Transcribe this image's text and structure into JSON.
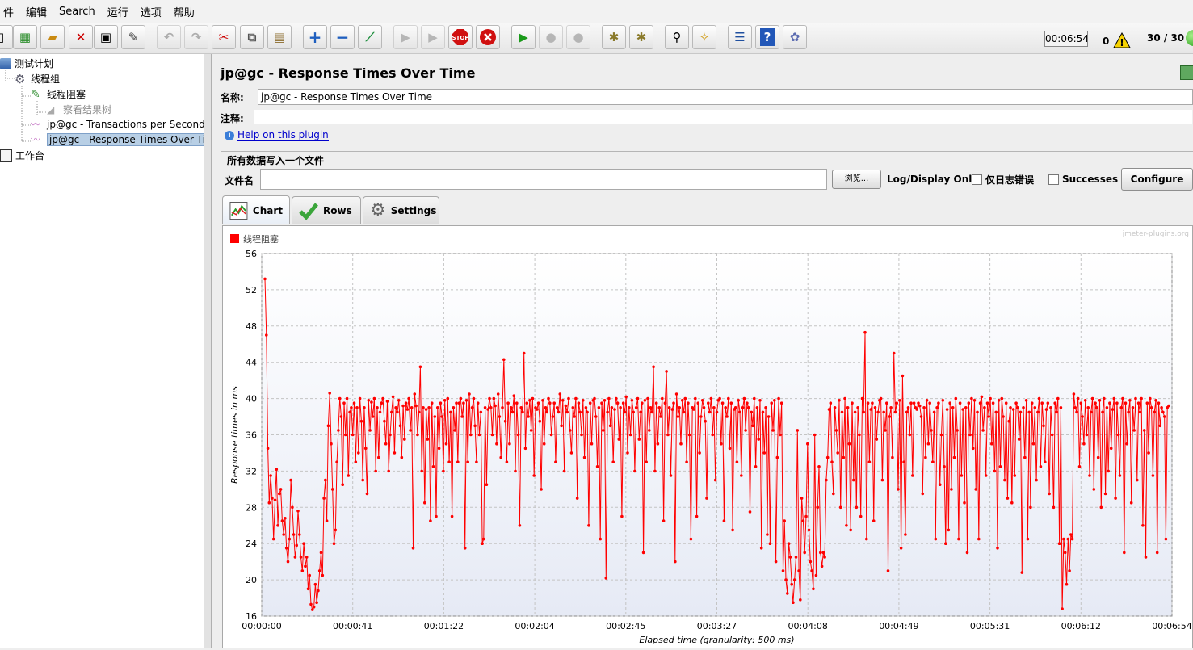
{
  "menu": [
    "件",
    "编辑",
    "Search",
    "运行",
    "选项",
    "帮助"
  ],
  "toolbar": {
    "timer": "00:06:54",
    "warnings": "0",
    "threads": "30 / 30"
  },
  "tree": {
    "items": [
      {
        "label": "测试计划"
      },
      {
        "label": "线程组"
      },
      {
        "label": "线程阻塞"
      },
      {
        "label": "察看结果树"
      },
      {
        "label": "jp@gc - Transactions per Second"
      },
      {
        "label": "jp@gc - Response Times Over Tim"
      },
      {
        "label": "工作台"
      }
    ]
  },
  "panel": {
    "title": "jp@gc - Response Times Over Time",
    "name_label": "名称:",
    "name_value": "jp@gc - Response Times Over Time",
    "comment_label": "注释:",
    "comment_value": "",
    "help_link": "Help on this plugin",
    "fileset_title": "所有数据写入一个文件",
    "filename_label": "文件名",
    "filename_value": "",
    "browse_label": "浏览...",
    "log_display_label": "Log/Display Only:",
    "errors_only_label": "仅日志错误",
    "successes_label": "Successes",
    "configure_label": "Configure"
  },
  "tabs": [
    {
      "label": "Chart",
      "icon": "chart-icon",
      "active": true
    },
    {
      "label": "Rows",
      "icon": "checkmark-icon",
      "active": false
    },
    {
      "label": "Settings",
      "icon": "gear-icon",
      "active": false
    }
  ],
  "colors": {
    "series": "#ff0000",
    "plot_bg_top": "#ffffff",
    "plot_bg_bottom": "#e6eaf5"
  },
  "chart_data": {
    "type": "line",
    "watermark": "jmeter-plugins.org",
    "ylabel": "Response times in ms",
    "xlabel": "Elapsed time (granularity: 500 ms)",
    "ylim": [
      16,
      56
    ],
    "yticks": [
      16,
      20,
      24,
      28,
      32,
      36,
      40,
      44,
      48,
      52,
      56
    ],
    "xticks": [
      "00:00:00",
      "00:00:41",
      "00:01:22",
      "00:02:04",
      "00:02:45",
      "00:03:27",
      "00:04:08",
      "00:04:49",
      "00:05:31",
      "00:06:12",
      "00:06:54"
    ],
    "x_range_seconds": [
      0,
      414
    ],
    "series": [
      {
        "name": "线程阻塞",
        "values": [
          53.2,
          47.0,
          34.5,
          28.5,
          31.5,
          29.0,
          24.5,
          28.8,
          32.2,
          26.0,
          29.5,
          30.0,
          26.5,
          25.0,
          26.8,
          23.5,
          22.0,
          24.5,
          31.0,
          28.0,
          25.0,
          22.5,
          23.8,
          27.6,
          25.0,
          22.5,
          21.0,
          24.0,
          21.5,
          22.5,
          19.0,
          20.5,
          17.3,
          16.7,
          17.0,
          19.5,
          17.5,
          18.8,
          21.0,
          23.0,
          20.5,
          29.0,
          31.0,
          26.5,
          37.0,
          40.6,
          35.0,
          30.0,
          24.0,
          25.5,
          33.0,
          36.5,
          40.0,
          38.0,
          30.5,
          39.5,
          36.0,
          40.0,
          31.5,
          38.5,
          39.0,
          36.0,
          39.5,
          33.0,
          39.0,
          34.0,
          40.0,
          37.5,
          31.0,
          39.0,
          34.5,
          29.5,
          39.8,
          36.5,
          39.6,
          38.0,
          40.0,
          32.0,
          39.0,
          33.5,
          38.5,
          39.5,
          40.0,
          37.5,
          35.0,
          39.7,
          32.0,
          36.0,
          38.5,
          40.2,
          34.0,
          39.0,
          38.5,
          39.8,
          37.0,
          33.5,
          39.2,
          35.5,
          39.5,
          38.8,
          40.0,
          36.5,
          39.0,
          23.5,
          40.5,
          39.2,
          36.0,
          38.5,
          43.5,
          32.0,
          39.0,
          28.5,
          38.8,
          35.5,
          39.0,
          26.5,
          39.5,
          32.5,
          38.0,
          27.0,
          39.0,
          34.5,
          39.5,
          38.0,
          32.0,
          39.8,
          35.0,
          40.0,
          33.0,
          38.5,
          27.0,
          39.0,
          36.5,
          39.5,
          33.0,
          39.5,
          40.0,
          38.0,
          39.5,
          23.5,
          39.8,
          33.0,
          40.5,
          36.0,
          39.0,
          40.0,
          37.0,
          33.0,
          39.5,
          36.0,
          38.5,
          24.0,
          24.5,
          39.0,
          30.5,
          38.8,
          40.0,
          39.0,
          36.0,
          40.0,
          39.2,
          35.0,
          40.5,
          38.0,
          33.5,
          39.0,
          44.3,
          37.5,
          33.0,
          39.5,
          35.0,
          39.0,
          38.5,
          40.3,
          32.0,
          39.5,
          36.0,
          26.0,
          39.0,
          38.5,
          45.0,
          34.5,
          39.5,
          38.0,
          39.8,
          36.5,
          40.0,
          31.5,
          39.0,
          38.8,
          39.5,
          37.5,
          30.0,
          39.8,
          35.0,
          39.0,
          38.5,
          40.0,
          39.5,
          36.0,
          38.0,
          39.5,
          33.0,
          39.0,
          38.5,
          40.5,
          37.0,
          39.8,
          32.0,
          39.2,
          38.5,
          40.0,
          36.5,
          34.0,
          39.0,
          38.0,
          40.0,
          29.0,
          39.5,
          38.5,
          36.0,
          39.8,
          33.5,
          39.0,
          38.5,
          26.0,
          39.5,
          35.0,
          39.8,
          40.0,
          38.0,
          32.5,
          39.0,
          24.5,
          39.5,
          36.5,
          39.8,
          20.2,
          38.5,
          40.0,
          37.0,
          39.0,
          33.0,
          38.8,
          40.0,
          39.5,
          35.5,
          39.0,
          27.0,
          39.5,
          38.5,
          40.2,
          34.0,
          39.0,
          36.0,
          39.8,
          38.5,
          32.0,
          39.0,
          40.0,
          35.5,
          38.5,
          39.5,
          23.0,
          39.8,
          33.0,
          40.0,
          36.5,
          39.0,
          38.5,
          43.5,
          32.0,
          39.5,
          35.0,
          39.0,
          38.0,
          40.0,
          26.5,
          39.5,
          43.0,
          36.0,
          39.0,
          31.5,
          38.8,
          39.5,
          22.0,
          40.5,
          38.0,
          39.0,
          35.0,
          39.8,
          38.5,
          40.0,
          33.0,
          39.5,
          36.0,
          24.5,
          39.0,
          38.8,
          40.0,
          27.0,
          39.5,
          34.0,
          38.0,
          39.8,
          39.0,
          37.5,
          29.0,
          39.5,
          38.5,
          40.0,
          36.0,
          39.0,
          31.0,
          38.5,
          39.8,
          40.0,
          35.0,
          39.5,
          26.5,
          39.0,
          38.0,
          40.0,
          34.5,
          39.5,
          25.5,
          38.8,
          39.0,
          33.0,
          39.8,
          38.5,
          31.5,
          39.0,
          40.0,
          36.5,
          39.5,
          39.0,
          27.5,
          38.5,
          37.0,
          40.0,
          32.5,
          39.0,
          35.5,
          39.8,
          23.5,
          38.5,
          34.0,
          39.0,
          25.0,
          38.0,
          24.0,
          39.5,
          36.5,
          39.8,
          22.0,
          33.5,
          40.0,
          36.0,
          39.5,
          21.0,
          26.5,
          20.0,
          18.5,
          24.0,
          22.5,
          19.5,
          17.5,
          20.0,
          22.5,
          36.5,
          21.0,
          17.8,
          29.0,
          26.5,
          23.0,
          27.0,
          35.0,
          25.5,
          22.0,
          21.0,
          19.0,
          36.0,
          20.5,
          28.0,
          32.5,
          23.0,
          21.5,
          23.0,
          22.5,
          31.0,
          33.5,
          38.8,
          39.5,
          33.0,
          29.5,
          39.0,
          36.5,
          34.0,
          39.8,
          28.0,
          38.5,
          33.5,
          40.0,
          26.0,
          39.0,
          35.0,
          25.5,
          39.5,
          31.0,
          38.5,
          28.0,
          39.0,
          36.0,
          27.0,
          40.0,
          38.5,
          47.3,
          24.5,
          39.5,
          33.0,
          38.8,
          39.5,
          26.5,
          39.0,
          35.5,
          38.5,
          39.8,
          40.0,
          31.0,
          38.5,
          36.5,
          39.5,
          21.0,
          38.0,
          39.0,
          33.5,
          45.0,
          38.5,
          39.5,
          30.0,
          39.8,
          23.5,
          42.5,
          33.0,
          25.0,
          38.5,
          39.0,
          36.0,
          39.5,
          31.5,
          39.5,
          39.0,
          38.8,
          39.5,
          39.2,
          38.0,
          29.5,
          39.0,
          33.5,
          39.8,
          35.0,
          39.5,
          36.5,
          33.0,
          38.5,
          24.5,
          39.0,
          39.5,
          30.5,
          36.0,
          39.8,
          32.5,
          24.0,
          38.8,
          25.5,
          39.5,
          30.0,
          39.0,
          33.5,
          40.0,
          36.5,
          24.5,
          39.5,
          31.5,
          38.8,
          28.5,
          39.0,
          23.0,
          39.5,
          36.0,
          40.0,
          34.5,
          39.8,
          30.0,
          38.5,
          24.5,
          39.5,
          40.2,
          36.5,
          39.0,
          31.5,
          39.5,
          38.0,
          40.0,
          35.0,
          39.5,
          32.0,
          38.5,
          23.5,
          39.8,
          32.5,
          40.0,
          38.0,
          31.0,
          39.5,
          29.0,
          37.5,
          39.0,
          28.5,
          38.8,
          31.5,
          39.5,
          39.0,
          35.5,
          38.5,
          20.8,
          39.0,
          33.5,
          39.8,
          24.5,
          38.5,
          28.0,
          39.5,
          35.0,
          39.0,
          31.0,
          38.5,
          40.0,
          32.5,
          39.5,
          37.0,
          33.0,
          38.8,
          39.5,
          29.5,
          39.0,
          36.0,
          28.0,
          39.5,
          38.5,
          40.0,
          24.0,
          39.0,
          16.8,
          24.5,
          23.0,
          19.5,
          24.5,
          21.0,
          25.0,
          24.5,
          40.5,
          39.0,
          38.5,
          40.0,
          32.5,
          39.5,
          38.0,
          35.0,
          39.8,
          36.0,
          39.0,
          31.5,
          38.5,
          40.0,
          30.0,
          39.5,
          39.0,
          33.5,
          39.8,
          28.0,
          38.5,
          40.0,
          29.5,
          39.0,
          32.0,
          39.5,
          34.5,
          38.8,
          40.0,
          29.0,
          39.5,
          36.0,
          31.5,
          39.0,
          40.0,
          23.0,
          39.5,
          35.0,
          38.5,
          39.8,
          28.5,
          39.0,
          36.5,
          40.0,
          31.0,
          39.5,
          38.5,
          40.0,
          26.0,
          36.5,
          22.5,
          39.5,
          34.0,
          40.0,
          39.0,
          31.5,
          38.5,
          39.8,
          23.0,
          39.5,
          37.0,
          39.0,
          38.5,
          38.0,
          24.5,
          39.0,
          39.2
        ]
      }
    ]
  }
}
